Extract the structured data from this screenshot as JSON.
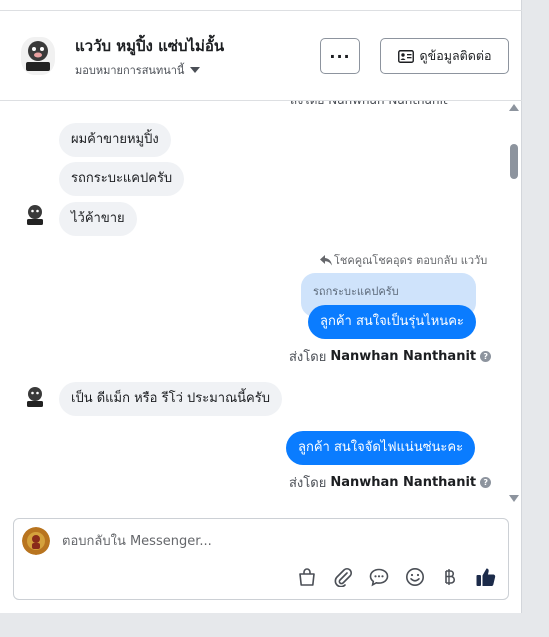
{
  "header": {
    "page_name": "แววับ หมูปิ้ง แซ่บไม่อั้น",
    "assign_label": "มอบหมายการสนทนานี้",
    "more_label": "···",
    "contact_label": "ดูข้อมูลติดต่อ"
  },
  "thread": {
    "cut_off_text": "ส่งโดย Nanwhan Nanthanit",
    "messages": [
      {
        "text": "ผมค้าขายหมูปิ้ง"
      },
      {
        "text": "รถกระบะแคปครับ"
      },
      {
        "text": "ไว้ค้าขาย"
      },
      {
        "reply_meta": "โชคคูณโชคอุดร ตอบกลับ แววับ",
        "quoted": "รถกระบะแคปครับ",
        "text": "ลูกค้า สนใจเป็นรุ่นไหนคะ",
        "sent_by_prefix": "ส่งโดย",
        "sent_by_name": "Nanwhan Nanthanit"
      },
      {
        "text": "เป็น ดีแม็ก หรือ รีโว่ ประมาณนี้ครับ"
      },
      {
        "text": "ลูกค้า สนใจจัดไฟแน่นซ่นะคะ",
        "sent_by_prefix": "ส่งโดย",
        "sent_by_name": "Nanwhan Nanthanit"
      }
    ]
  },
  "composer": {
    "placeholder": "ตอบกลับใน Messenger...",
    "tools": [
      "shop-bag-icon",
      "paperclip-icon",
      "saved-reply-icon",
      "emoji-icon",
      "baht-icon",
      "thumbs-up-icon"
    ]
  },
  "colors": {
    "outgoing": "#0a7cff",
    "incoming": "#f0f2f5",
    "quote": "#cfe3fb",
    "thumbs_up": "#1c2b4a"
  }
}
